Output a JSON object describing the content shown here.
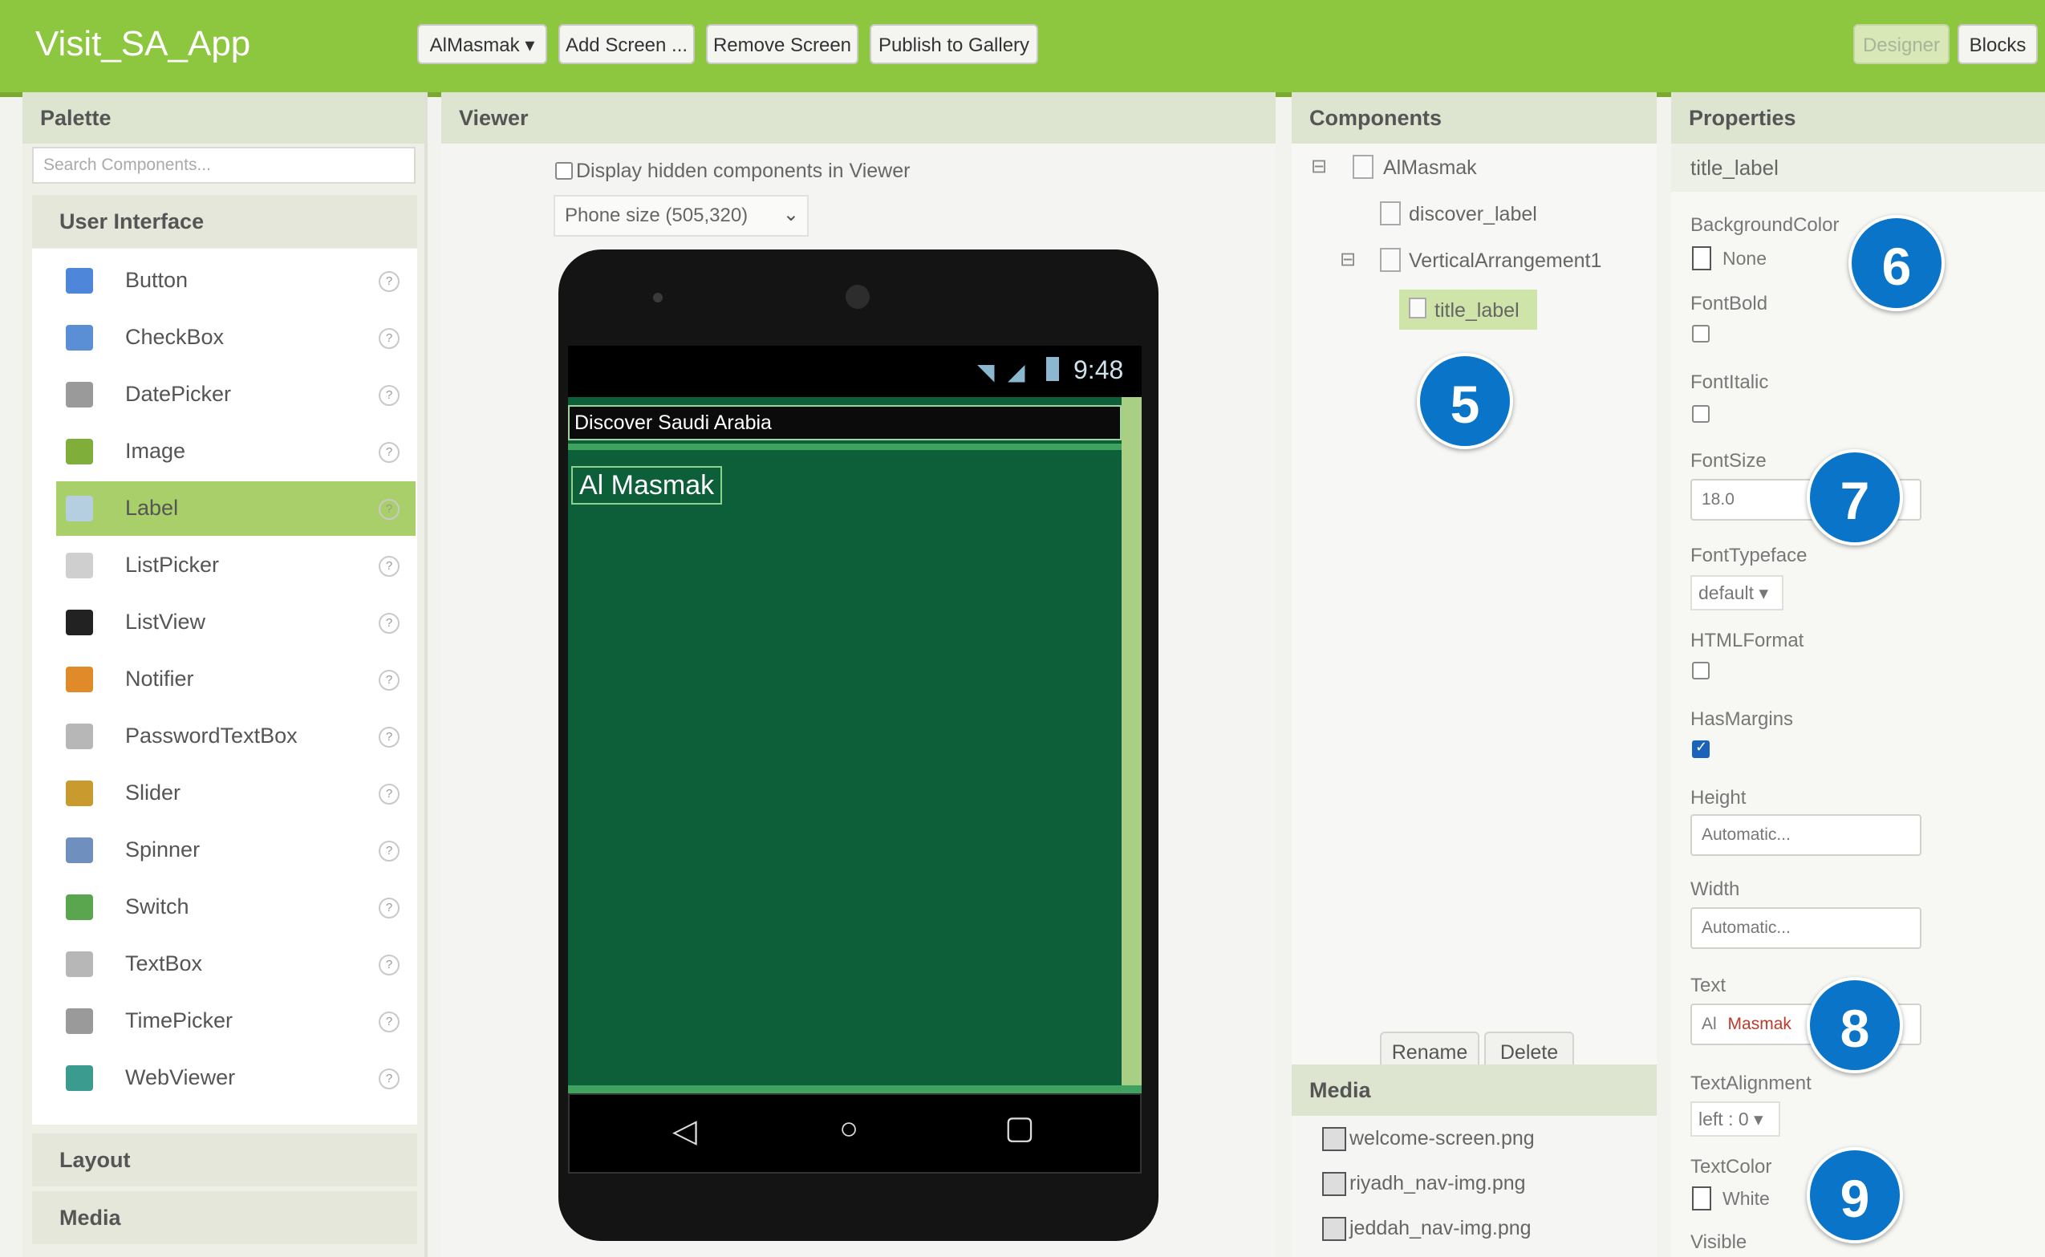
{
  "app": {
    "title": "Visit_SA_App"
  },
  "toolbar": {
    "screen_select": "AlMasmak ▾",
    "add_screen": "Add Screen ...",
    "remove_screen": "Remove Screen",
    "publish": "Publish to Gallery",
    "designer": "Designer",
    "blocks": "Blocks"
  },
  "palette": {
    "header": "Palette",
    "search_placeholder": "Search Components...",
    "group_ui": "User Interface",
    "items": [
      {
        "label": "Button",
        "icon": "button-icon",
        "color": "#4e86d9"
      },
      {
        "label": "CheckBox",
        "icon": "checkbox-icon",
        "color": "#5a8fd6"
      },
      {
        "label": "DatePicker",
        "icon": "datepicker-icon",
        "color": "#9a9a9a"
      },
      {
        "label": "Image",
        "icon": "image-icon",
        "color": "#7fae3b"
      },
      {
        "label": "Label",
        "icon": "label-icon",
        "color": "#b5cfe0"
      },
      {
        "label": "ListPicker",
        "icon": "listpicker-icon",
        "color": "#cfcfcf"
      },
      {
        "label": "ListView",
        "icon": "listview-icon",
        "color": "#222222"
      },
      {
        "label": "Notifier",
        "icon": "notifier-icon",
        "color": "#e08a2a"
      },
      {
        "label": "PasswordTextBox",
        "icon": "password-textbox-icon",
        "color": "#b7b7b7"
      },
      {
        "label": "Slider",
        "icon": "slider-icon",
        "color": "#c99a2e"
      },
      {
        "label": "Spinner",
        "icon": "spinner-icon",
        "color": "#6f8fbf"
      },
      {
        "label": "Switch",
        "icon": "switch-icon",
        "color": "#5aa64e"
      },
      {
        "label": "TextBox",
        "icon": "textbox-icon",
        "color": "#b7b7b7"
      },
      {
        "label": "TimePicker",
        "icon": "timepicker-icon",
        "color": "#9a9a9a"
      },
      {
        "label": "WebViewer",
        "icon": "webviewer-icon",
        "color": "#3a9b8e"
      }
    ],
    "active_item": "Label",
    "help_glyph": "?",
    "group_layout": "Layout",
    "group_media": "Media"
  },
  "viewer": {
    "header": "Viewer",
    "display_hidden_label": "Display hidden components in Viewer",
    "phone_size": "Phone size (505,320)",
    "status_time": "9:48",
    "discover_label": "Discover Saudi Arabia",
    "title_label": "Al Masmak",
    "screen_bg": "#0d5f3a"
  },
  "components": {
    "header": "Components",
    "root": "AlMasmak",
    "discover_label": "discover_label",
    "arrangement": "VerticalArrangement1",
    "selected": "title_label",
    "rename": "Rename",
    "delete": "Delete"
  },
  "media": {
    "header": "Media",
    "files": [
      "welcome-screen.png",
      "riyadh_nav-img.png",
      "jeddah_nav-img.png"
    ]
  },
  "properties": {
    "header": "Properties",
    "component": "title_label",
    "background_color_label": "BackgroundColor",
    "background_color_value": "None",
    "font_bold_label": "FontBold",
    "font_italic_label": "FontItalic",
    "font_size_label": "FontSize",
    "font_size_value": "18.0",
    "font_typeface_label": "FontTypeface",
    "font_typeface_value": "default ▾",
    "html_format_label": "HTMLFormat",
    "has_margins_label": "HasMargins",
    "height_label": "Height",
    "height_value": "Automatic...",
    "width_label": "Width",
    "width_value": "Automatic...",
    "text_label": "Text",
    "text_prefix": "Al",
    "text_value": "Masmak",
    "text_alignment_label": "TextAlignment",
    "text_alignment_value": "left : 0 ▾",
    "text_color_label": "TextColor",
    "text_color_value": "White",
    "visible_label": "Visible"
  },
  "callouts": [
    "5",
    "6",
    "7",
    "8",
    "9"
  ],
  "colors": {
    "accent": "#8dc63f",
    "callout": "#0a74c8"
  }
}
